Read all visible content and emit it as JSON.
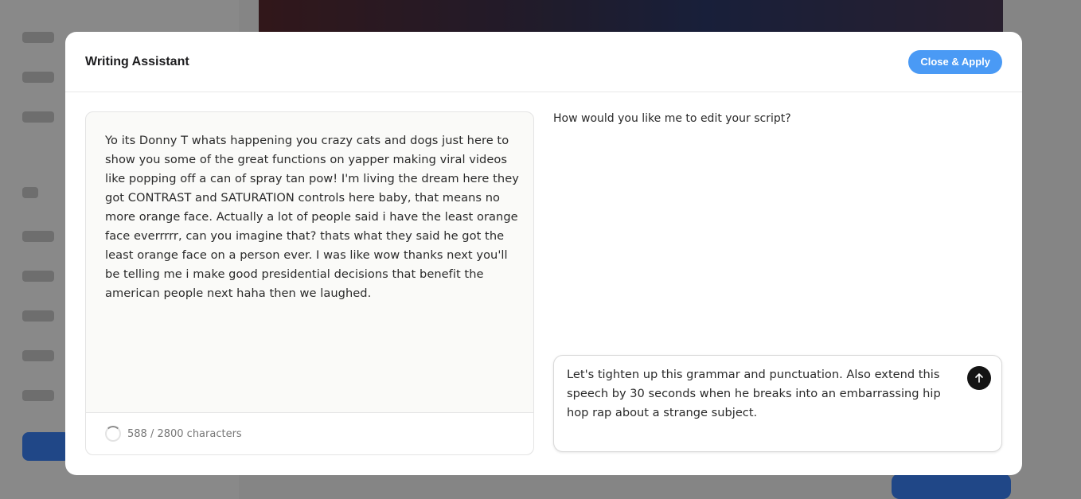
{
  "modal": {
    "title": "Writing Assistant",
    "apply_button_label": "Close & Apply"
  },
  "script_editor": {
    "text": "Yo its Donny T whats happening you crazy cats and dogs just here to show you some of the great functions on yapper making viral videos like popping off a can of spray tan pow! I'm living the dream here they got CONTRAST and SATURATION controls here baby, that means no more orange face. Actually a lot of people said i have the least orange face everrrrr, can you imagine that? thats what they said he got the least orange face on a person ever. I was like wow thanks next you'll be telling me i make good presidential decisions that benefit the american people next haha then we laughed.",
    "char_count_label": "588 / 2800 characters",
    "char_count": 588,
    "char_limit": 2800
  },
  "assistant": {
    "question": "How would you like me to edit your script?",
    "input_value": "Let's tighten up this grammar and punctuation. Also extend this speech by 30 seconds when he breaks into an embarrassing hip hop rap about a strange subject.",
    "send_icon": "arrow-up-icon"
  },
  "colors": {
    "accent": "#4a9af5",
    "send_button": "#141414",
    "editor_bg": "#fafaf8"
  }
}
